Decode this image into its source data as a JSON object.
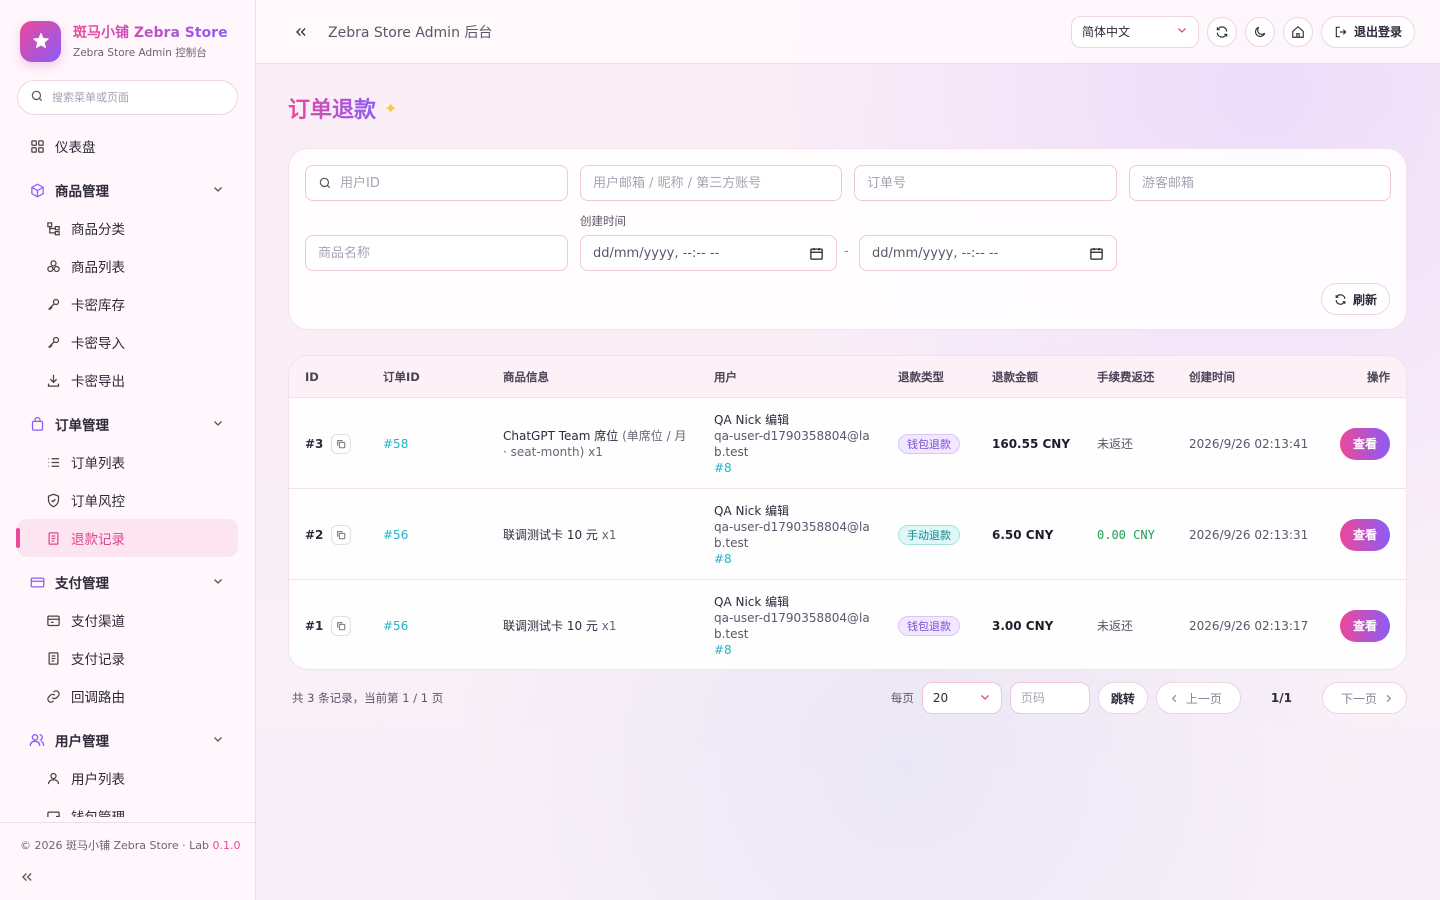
{
  "brand": {
    "title": "斑马小铺 Zebra Store",
    "subtitle": "Zebra Store Admin 控制台"
  },
  "sidebar": {
    "search_placeholder": "搜索菜单或页面",
    "dashboard": "仪表盘",
    "groups": [
      {
        "label": "商品管理",
        "items": [
          "商品分类",
          "商品列表",
          "卡密库存",
          "卡密导入",
          "卡密导出"
        ]
      },
      {
        "label": "订单管理",
        "items": [
          "订单列表",
          "订单风控",
          "退款记录"
        ]
      },
      {
        "label": "支付管理",
        "items": [
          "支付渠道",
          "支付记录",
          "回调路由"
        ]
      },
      {
        "label": "用户管理",
        "items": [
          "用户列表",
          "钱包管理"
        ]
      }
    ],
    "active_item": "退款记录",
    "footer": {
      "copyright": "© 2026 斑马小铺 Zebra Store · Lab ",
      "version": "0.1.0"
    }
  },
  "topbar": {
    "title": "Zebra Store Admin 后台",
    "language": "简体中文",
    "logout": "退出登录"
  },
  "page": {
    "title": "订单退款"
  },
  "filters": {
    "user_id_placeholder": "用户ID",
    "user_email_placeholder": "用户邮箱 / 昵称 / 第三方账号",
    "order_no_placeholder": "订单号",
    "guest_email_placeholder": "游客邮箱",
    "product_name_placeholder": "商品名称",
    "created_time_label": "创建时间",
    "date_start": "dd/mm/yyyy, --:-- --",
    "date_end": "dd/mm/yyyy, --:-- --",
    "date_separator": "-",
    "refresh": "刷新"
  },
  "table": {
    "columns": [
      "ID",
      "订单ID",
      "商品信息",
      "用户",
      "退款类型",
      "退款金额",
      "手续费返还",
      "创建时间",
      "操作"
    ],
    "rows": [
      {
        "id": "#3",
        "order_id": "#58",
        "product": "ChatGPT Team 席位",
        "product_detail": " (单席位 / 月 · seat-month)",
        "qty": " x1",
        "user_name": "QA Nick 编辑",
        "user_email": "qa-user-d1790358804@lab.test",
        "user_id": "#8",
        "refund_type": "钱包退款",
        "refund_type_kind": "wallet",
        "amount": "160.55 CNY",
        "fee_refund": "未返还",
        "created_at": "2026/9/26 02:13:41",
        "action": "查看"
      },
      {
        "id": "#2",
        "order_id": "#56",
        "product": "联调测试卡 10 元",
        "product_detail": "",
        "qty": " x1",
        "user_name": "QA Nick 编辑",
        "user_email": "qa-user-d1790358804@lab.test",
        "user_id": "#8",
        "refund_type": "手动退款",
        "refund_type_kind": "manual",
        "amount": "6.50 CNY",
        "fee_refund": "0.00 CNY",
        "created_at": "2026/9/26 02:13:31",
        "action": "查看"
      },
      {
        "id": "#1",
        "order_id": "#56",
        "product": "联调测试卡 10 元",
        "product_detail": "",
        "qty": " x1",
        "user_name": "QA Nick 编辑",
        "user_email": "qa-user-d1790358804@lab.test",
        "user_id": "#8",
        "refund_type": "钱包退款",
        "refund_type_kind": "wallet",
        "amount": "3.00 CNY",
        "fee_refund": "未返还",
        "created_at": "2026/9/26 02:13:17",
        "action": "查看"
      }
    ]
  },
  "pagination": {
    "summary": "共 3 条记录，当前第 1 / 1 页",
    "per_page_label": "每页",
    "per_page": "20",
    "page_input_placeholder": "页码",
    "jump": "跳转",
    "prev": "上一页",
    "indicator": "1/1",
    "next": "下一页"
  },
  "colors": {
    "accent_pink": "#ec4899",
    "accent_purple": "#8b5cf6",
    "link": "#22b3c9",
    "fee_positive": "#1f9d55"
  }
}
